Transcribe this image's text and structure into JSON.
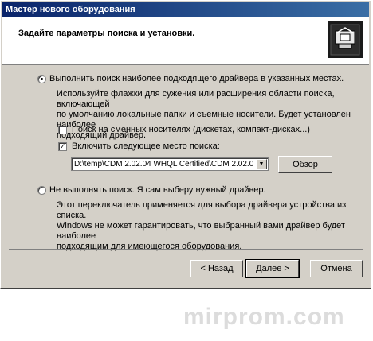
{
  "window": {
    "title": "Мастер нового оборудования"
  },
  "header": {
    "title": "Задайте параметры поиска и установки.",
    "icon": "hardware-wizard-icon"
  },
  "options": {
    "search_radio_label": "Выполнить поиск наиболее подходящего драйвера в указанных местах.",
    "search_description_1": "Используйте флажки для сужения или расширения области поиска, включающей",
    "search_description_2": "по умолчанию локальные папки и съемные носители. Будет установлен наиболее",
    "search_description_3": "подходящий драйвер.",
    "removable_checkbox_label": "Поиск на сменных носителях (дискетах, компакт-дисках...)",
    "include_location_checkbox_label": "Включить следующее место поиска:",
    "location_value": "D:\\temp\\CDM 2.02.04 WHQL Certified\\CDM 2.02.0",
    "browse_button_label": "Обзор",
    "manual_radio_label": "Не выполнять поиск. Я сам выберу нужный драйвер.",
    "manual_description_1": "Этот переключатель применяется для выбора драйвера устройства из списка.",
    "manual_description_2": "Windows не может гарантировать, что выбранный вами драйвер будет наиболее",
    "manual_description_3": "подходящим для имеющегося оборудования."
  },
  "buttons": {
    "back": "< Назад",
    "next": "Далее >",
    "cancel": "Отмена"
  },
  "watermark": "mirprom.com"
}
